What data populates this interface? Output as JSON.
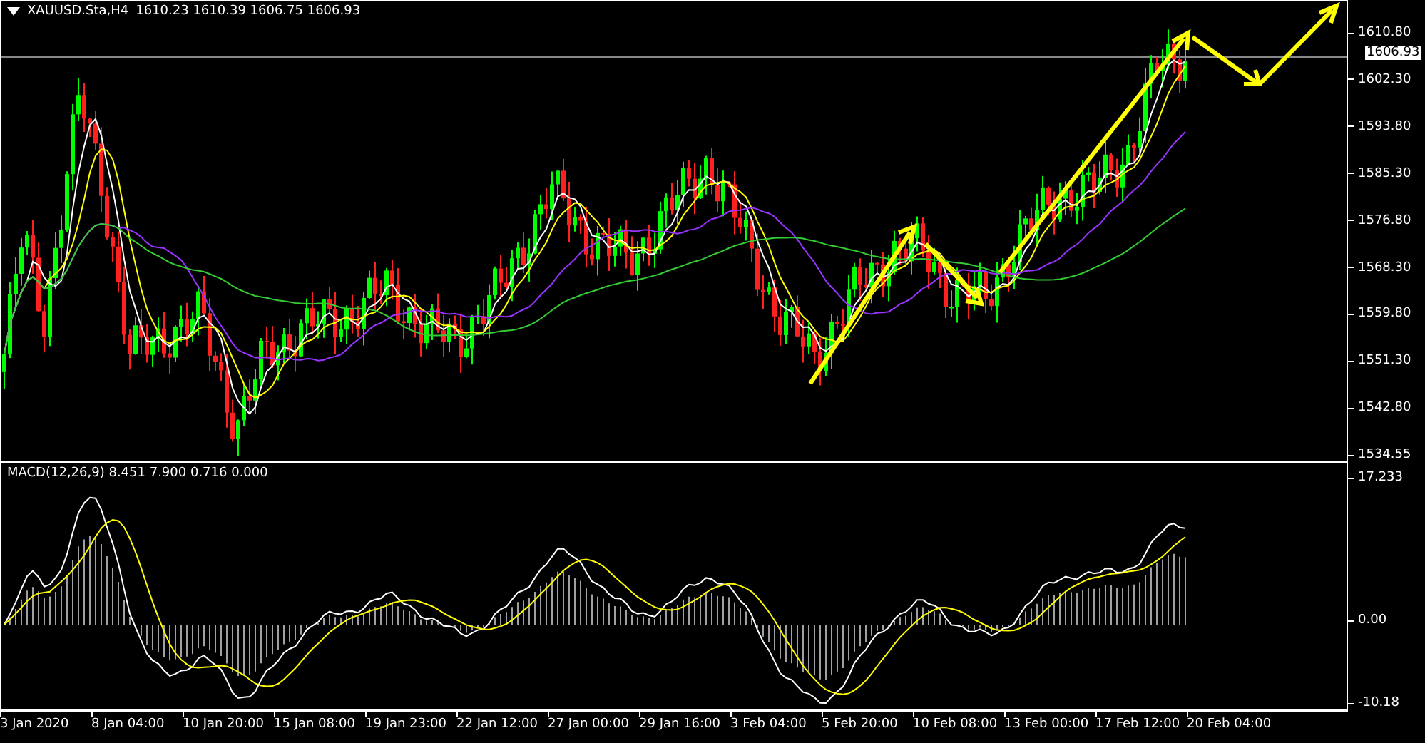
{
  "chart": {
    "symbol": "XAUUSD.Sta,H4",
    "ohlc": "1610.23 1610.39 1606.75 1606.93",
    "current_price": "1606.93",
    "price_axis": [
      "1610.80",
      "1602.30",
      "1593.80",
      "1585.30",
      "1576.80",
      "1568.30",
      "1559.80",
      "1551.30",
      "1542.80",
      "1534.55"
    ]
  },
  "macd": {
    "label": "MACD(12,26,9) 8.451 7.900 0.716 0.000",
    "axis": [
      "17.233",
      "0.00",
      "-10.18"
    ]
  },
  "time_axis": [
    "3 Jan 2020",
    "8 Jan 04:00",
    "10 Jan 20:00",
    "15 Jan 08:00",
    "19 Jan 23:00",
    "22 Jan 12:00",
    "27 Jan 00:00",
    "29 Jan 16:00",
    "3 Feb 04:00",
    "5 Feb 20:00",
    "10 Feb 08:00",
    "13 Feb 00:00",
    "17 Feb 12:00",
    "20 Feb 04:00"
  ]
}
